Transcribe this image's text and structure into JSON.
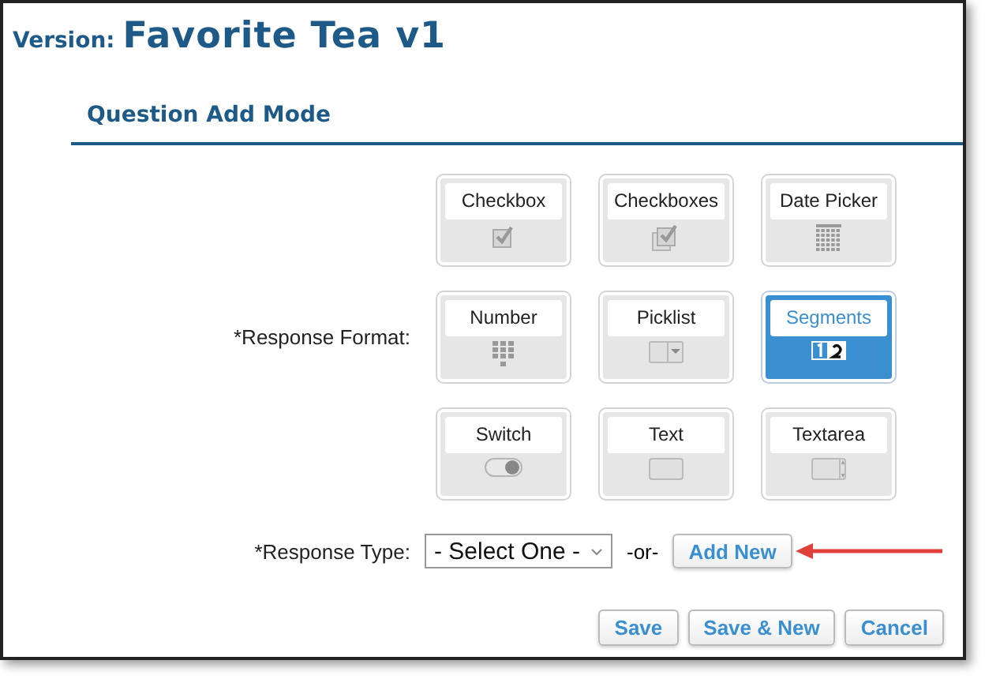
{
  "header": {
    "prefix": "Version:",
    "title": "Favorite Tea v1"
  },
  "section": {
    "title": "Question Add Mode"
  },
  "response_format": {
    "label": "*Response Format:",
    "options": [
      {
        "label": "Checkbox",
        "kind": "checkbox",
        "selected": false
      },
      {
        "label": "Checkboxes",
        "kind": "checkboxes",
        "selected": false
      },
      {
        "label": "Date Picker",
        "kind": "calendar",
        "selected": false
      },
      {
        "label": "Number",
        "kind": "keypad",
        "selected": false
      },
      {
        "label": "Picklist",
        "kind": "picklist",
        "selected": false
      },
      {
        "label": "Segments",
        "kind": "segments",
        "selected": true
      },
      {
        "label": "Switch",
        "kind": "switch",
        "selected": false
      },
      {
        "label": "Text",
        "kind": "text",
        "selected": false
      },
      {
        "label": "Textarea",
        "kind": "textarea",
        "selected": false
      }
    ]
  },
  "response_type": {
    "label": "*Response Type:",
    "value": "- Select One -",
    "separator": "-or-",
    "add_button": "Add New"
  },
  "buttons": [
    "Save",
    "Save & New",
    "Cancel"
  ]
}
